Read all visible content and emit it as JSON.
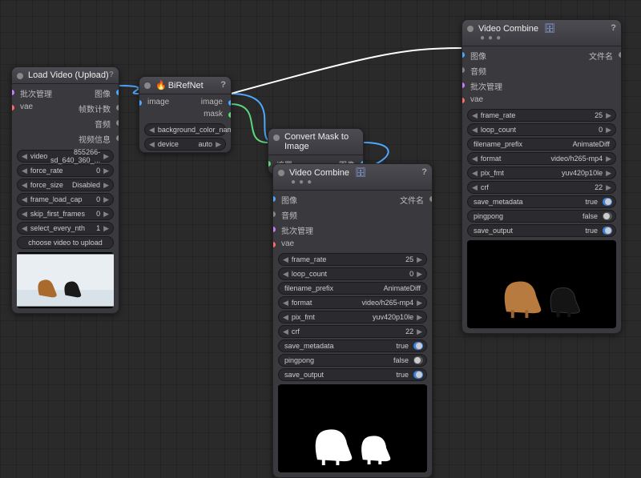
{
  "nodes": {
    "loadVideo": {
      "title": "Load Video (Upload)",
      "outputs": [
        "图像",
        "帧数计数",
        "音频",
        "视频信息"
      ],
      "inputs": {
        "batch": "批次管理",
        "vae": "vae"
      },
      "params": {
        "video": {
          "label": "video",
          "value": "855266-sd_640_360_..."
        },
        "force_rate": {
          "label": "force_rate",
          "value": "0"
        },
        "force_size": {
          "label": "force_size",
          "value": "Disabled"
        },
        "frame_load_cap": {
          "label": "frame_load_cap",
          "value": "0"
        },
        "skip_first_frames": {
          "label": "skip_first_frames",
          "value": "0"
        },
        "select_every_nth": {
          "label": "select_every_nth",
          "value": "1"
        }
      },
      "button": "choose video to upload"
    },
    "birefnet": {
      "title": "BiRefNet",
      "inputs": {
        "image": "image"
      },
      "outputs": [
        "image",
        "mask"
      ],
      "params": {
        "bgcolor": {
          "label": "background_color_name",
          "value": ""
        },
        "device": {
          "label": "device",
          "value": "auto"
        }
      }
    },
    "mask2img": {
      "title": "Convert Mask to Image",
      "input": "遮罩",
      "output": "图像"
    },
    "vcombine": {
      "title": "Video Combine",
      "inputs": [
        "图像",
        "音频",
        "批次管理",
        "vae"
      ],
      "output": "文件名",
      "params": {
        "frame_rate": {
          "label": "frame_rate",
          "value": "25"
        },
        "loop_count": {
          "label": "loop_count",
          "value": "0"
        },
        "filename_prefix": {
          "label": "filename_prefix",
          "value": "AnimateDiff"
        },
        "format": {
          "label": "format",
          "value": "video/h265-mp4"
        },
        "pix_fmt": {
          "label": "pix_fmt",
          "value": "yuv420p10le"
        },
        "crf": {
          "label": "crf",
          "value": "22"
        },
        "save_metadata": {
          "label": "save_metadata",
          "value": "true",
          "on": true
        },
        "pingpong": {
          "label": "pingpong",
          "value": "false",
          "on": false
        },
        "save_output": {
          "label": "save_output",
          "value": "true",
          "on": true
        }
      }
    }
  },
  "chart_data": null
}
